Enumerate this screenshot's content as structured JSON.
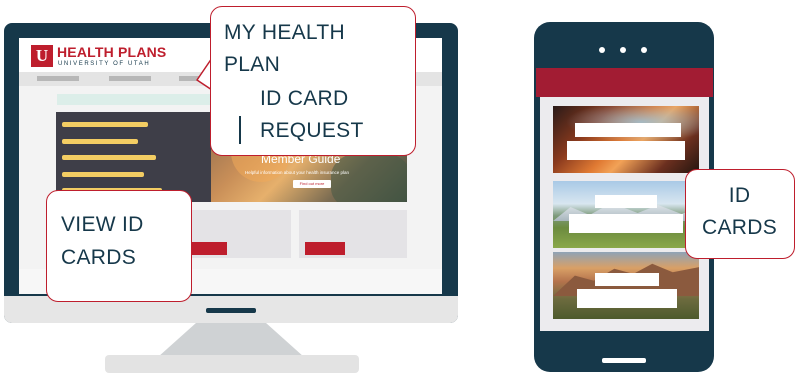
{
  "colors": {
    "navy": "#16384a",
    "brand_red": "#be1e2d",
    "crimson": "#a21c33",
    "bubble_text": "#16384a"
  },
  "website": {
    "logo_title": "HEALTH PLANS",
    "logo_subtitle": "UNIVERSITY OF UTAH",
    "hero_heading": "Member Guide",
    "hero_subtext": "Helpful information about your health insurance plan",
    "hero_button": "Find out more"
  },
  "callouts": {
    "my_health_plan": [
      "MY HEALTH",
      "PLAN"
    ],
    "id_card_request": [
      "ID CARD",
      "REQUEST"
    ],
    "view_id_cards": [
      "VIEW ID",
      "CARDS"
    ],
    "id_cards": [
      "ID",
      "CARDS"
    ]
  },
  "phone": {
    "dots": [
      "dot",
      "dot",
      "dot"
    ],
    "cards": [
      {
        "scene": "canyon"
      },
      {
        "scene": "mountain-meadow"
      },
      {
        "scene": "desert-mountain"
      }
    ]
  }
}
